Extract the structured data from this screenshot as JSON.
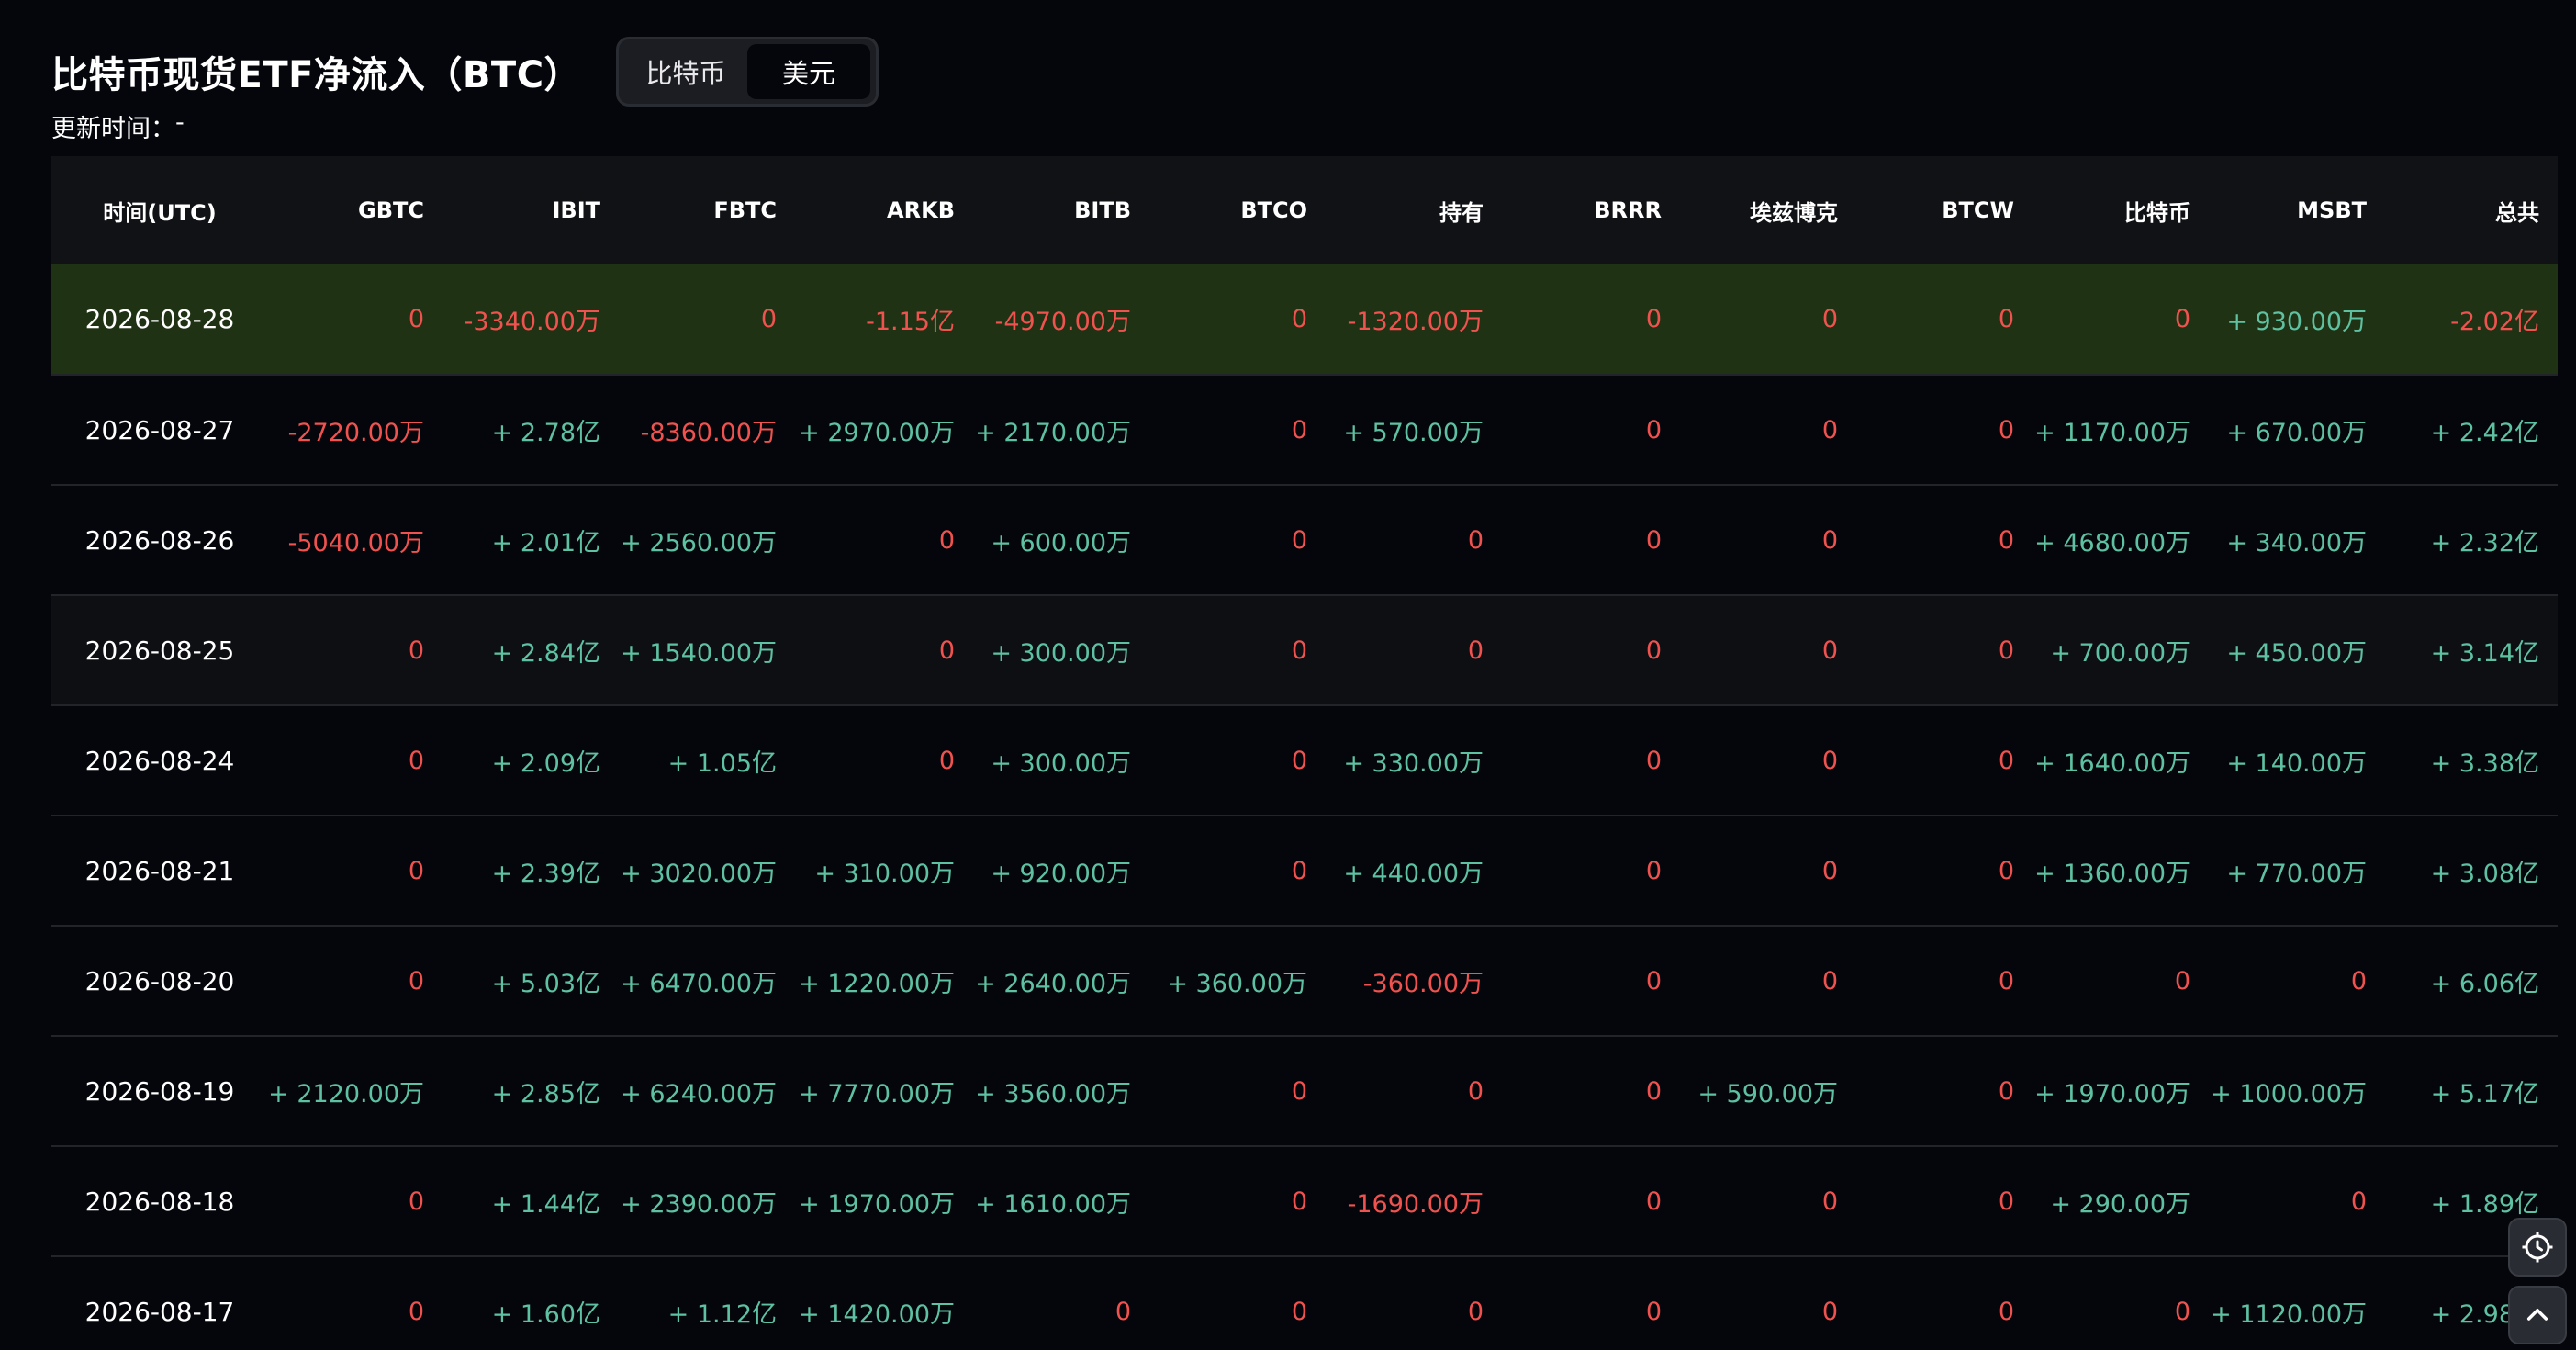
{
  "header": {
    "title": "比特币现货ETF净流入（BTC）",
    "toggle": [
      {
        "label": "比特币",
        "active": false
      },
      {
        "label": "美元",
        "active": true
      }
    ],
    "update_label": "更新时间：",
    "update_value": "-"
  },
  "colors": {
    "positive": "#5ec1a1",
    "negative": "#f0524f",
    "highlight_row": "#1f3314",
    "background": "#05060b"
  },
  "table": {
    "columns": [
      "时间(UTC)",
      "GBTC",
      "IBIT",
      "FBTC",
      "ARKB",
      "BITB",
      "BTCO",
      "持有",
      "BRRR",
      "埃兹博克",
      "BTCW",
      "比特币",
      "MSBT",
      "总共"
    ],
    "rows": [
      {
        "date": "2026-08-28",
        "highlight": true,
        "cells": [
          "0",
          "-3340.00万",
          "0",
          "-1.15亿",
          "-4970.00万",
          "0",
          "-1320.00万",
          "0",
          "0",
          "0",
          "0",
          "+ 930.00万",
          "-2.02亿"
        ]
      },
      {
        "date": "2026-08-27",
        "cells": [
          "-2720.00万",
          "+ 2.78亿",
          "-8360.00万",
          "+ 2970.00万",
          "+ 2170.00万",
          "0",
          "+ 570.00万",
          "0",
          "0",
          "0",
          "+ 1170.00万",
          "+ 670.00万",
          "+ 2.42亿"
        ]
      },
      {
        "date": "2026-08-26",
        "cells": [
          "-5040.00万",
          "+ 2.01亿",
          "+ 2560.00万",
          "0",
          "+ 600.00万",
          "0",
          "0",
          "0",
          "0",
          "0",
          "+ 4680.00万",
          "+ 340.00万",
          "+ 2.32亿"
        ]
      },
      {
        "date": "2026-08-25",
        "alt": true,
        "cells": [
          "0",
          "+ 2.84亿",
          "+ 1540.00万",
          "0",
          "+ 300.00万",
          "0",
          "0",
          "0",
          "0",
          "0",
          "+ 700.00万",
          "+ 450.00万",
          "+ 3.14亿"
        ]
      },
      {
        "date": "2026-08-24",
        "cells": [
          "0",
          "+ 2.09亿",
          "+ 1.05亿",
          "0",
          "+ 300.00万",
          "0",
          "+ 330.00万",
          "0",
          "0",
          "0",
          "+ 1640.00万",
          "+ 140.00万",
          "+ 3.38亿"
        ]
      },
      {
        "date": "2026-08-21",
        "cells": [
          "0",
          "+ 2.39亿",
          "+ 3020.00万",
          "+ 310.00万",
          "+ 920.00万",
          "0",
          "+ 440.00万",
          "0",
          "0",
          "0",
          "+ 1360.00万",
          "+ 770.00万",
          "+ 3.08亿"
        ]
      },
      {
        "date": "2026-08-20",
        "cells": [
          "0",
          "+ 5.03亿",
          "+ 6470.00万",
          "+ 1220.00万",
          "+ 2640.00万",
          "+ 360.00万",
          "-360.00万",
          "0",
          "0",
          "0",
          "0",
          "0",
          "+ 6.06亿"
        ]
      },
      {
        "date": "2026-08-19",
        "cells": [
          "+ 2120.00万",
          "+ 2.85亿",
          "+ 6240.00万",
          "+ 7770.00万",
          "+ 3560.00万",
          "0",
          "0",
          "0",
          "+ 590.00万",
          "0",
          "+ 1970.00万",
          "+ 1000.00万",
          "+ 5.17亿"
        ]
      },
      {
        "date": "2026-08-18",
        "cells": [
          "0",
          "+ 1.44亿",
          "+ 2390.00万",
          "+ 1970.00万",
          "+ 1610.00万",
          "0",
          "-1690.00万",
          "0",
          "0",
          "0",
          "+ 290.00万",
          "0",
          "+ 1.89亿"
        ]
      },
      {
        "date": "2026-08-17",
        "cells": [
          "0",
          "+ 1.60亿",
          "+ 1.12亿",
          "+ 1420.00万",
          "0",
          "0",
          "0",
          "0",
          "0",
          "0",
          "0",
          "+ 1120.00万",
          "+ 2.98亿"
        ]
      }
    ]
  },
  "float_buttons": [
    {
      "icon": "settings-icon"
    },
    {
      "icon": "chevron-up-icon"
    }
  ]
}
